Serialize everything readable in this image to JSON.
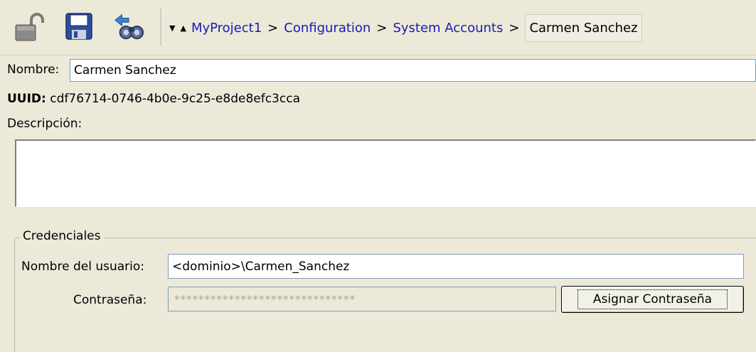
{
  "toolbar": {
    "icons": [
      "unlock-icon",
      "save-icon",
      "find-references-icon"
    ],
    "nav_down": "▼",
    "nav_up": "▲",
    "breadcrumb": {
      "items": [
        "MyProject1",
        "Configuration",
        "System Accounts"
      ],
      "separator": ">",
      "current": "Carmen Sanchez"
    }
  },
  "form": {
    "name_label": "Nombre:",
    "name_value": "Carmen Sanchez",
    "uuid_label": "UUID:",
    "uuid_value": "cdf76714-0746-4b0e-9c25-e8de8efc3cca",
    "description_label": "Descripción:",
    "description_value": ""
  },
  "credentials": {
    "legend": "Credenciales",
    "username_label": "Nombre del usuario:",
    "username_value": "<dominio>\\Carmen_Sanchez",
    "password_label": "Contraseña:",
    "password_value": "******************************",
    "set_password_button": "Asignar Contraseña"
  },
  "colors": {
    "window_bg": "#ece9d8",
    "link": "#1a1ab4",
    "field_border": "#7f9db9"
  }
}
